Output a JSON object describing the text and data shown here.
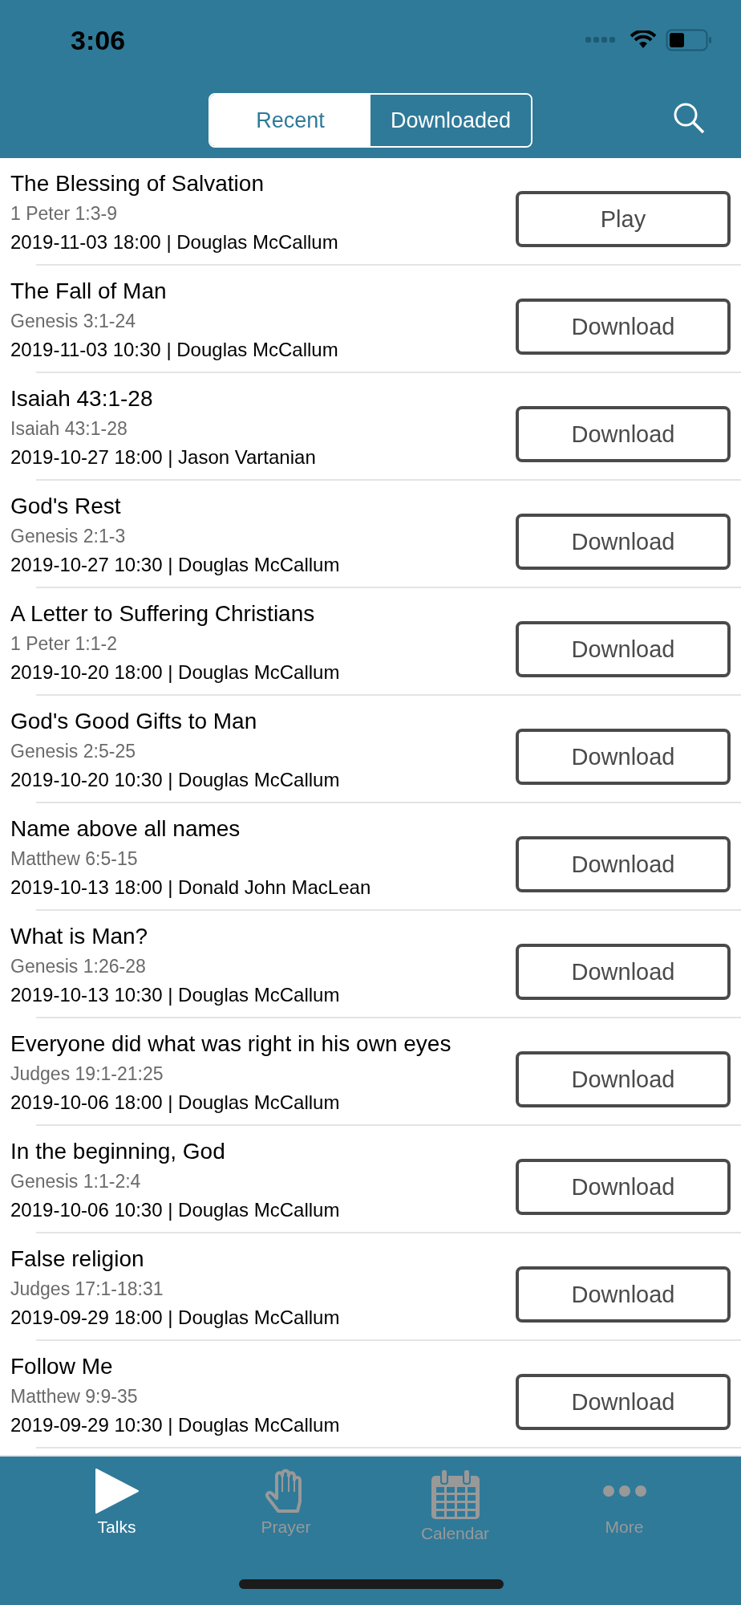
{
  "status_bar": {
    "time": "3:06"
  },
  "segments": [
    {
      "label": "Recent",
      "selected": true
    },
    {
      "label": "Downloaded",
      "selected": false
    }
  ],
  "talks": [
    {
      "title": "The Blessing of Salvation",
      "passage": "1 Peter 1:3-9",
      "meta": "2019-11-03 18:00 | Douglas McCallum",
      "action": "Play"
    },
    {
      "title": "The Fall of Man",
      "passage": "Genesis 3:1-24",
      "meta": "2019-11-03 10:30 | Douglas McCallum",
      "action": "Download"
    },
    {
      "title": "Isaiah 43:1-28",
      "passage": "Isaiah 43:1-28",
      "meta": "2019-10-27 18:00 | Jason Vartanian",
      "action": "Download"
    },
    {
      "title": "God's Rest",
      "passage": "Genesis 2:1-3",
      "meta": "2019-10-27 10:30 | Douglas McCallum",
      "action": "Download"
    },
    {
      "title": "A Letter to Suffering Christians",
      "passage": "1 Peter 1:1-2",
      "meta": "2019-10-20 18:00 | Douglas McCallum",
      "action": "Download"
    },
    {
      "title": "God's Good Gifts to Man",
      "passage": "Genesis 2:5-25",
      "meta": "2019-10-20 10:30 | Douglas McCallum",
      "action": "Download"
    },
    {
      "title": "Name above all names",
      "passage": "Matthew 6:5-15",
      "meta": "2019-10-13 18:00 | Donald John MacLean",
      "action": "Download"
    },
    {
      "title": "What is Man?",
      "passage": "Genesis 1:26-28",
      "meta": "2019-10-13 10:30 | Douglas McCallum",
      "action": "Download"
    },
    {
      "title": "Everyone did what was right in his own eyes",
      "passage": "Judges 19:1-21:25",
      "meta": "2019-10-06 18:00 | Douglas McCallum",
      "action": "Download"
    },
    {
      "title": "In the beginning, God",
      "passage": "Genesis 1:1-2:4",
      "meta": "2019-10-06 10:30 | Douglas McCallum",
      "action": "Download"
    },
    {
      "title": "False religion",
      "passage": "Judges 17:1-18:31",
      "meta": "2019-09-29 18:00 | Douglas McCallum",
      "action": "Download"
    },
    {
      "title": "Follow Me",
      "passage": "Matthew 9:9-35",
      "meta": "2019-09-29 10:30 | Douglas McCallum",
      "action": "Download"
    }
  ],
  "tab_bar": [
    {
      "label": "Talks",
      "kind": "play",
      "selected": true
    },
    {
      "label": "Prayer",
      "kind": "hand",
      "selected": false
    },
    {
      "label": "Calendar",
      "kind": "calendar",
      "selected": false
    },
    {
      "label": "More",
      "kind": "more",
      "selected": false
    }
  ]
}
